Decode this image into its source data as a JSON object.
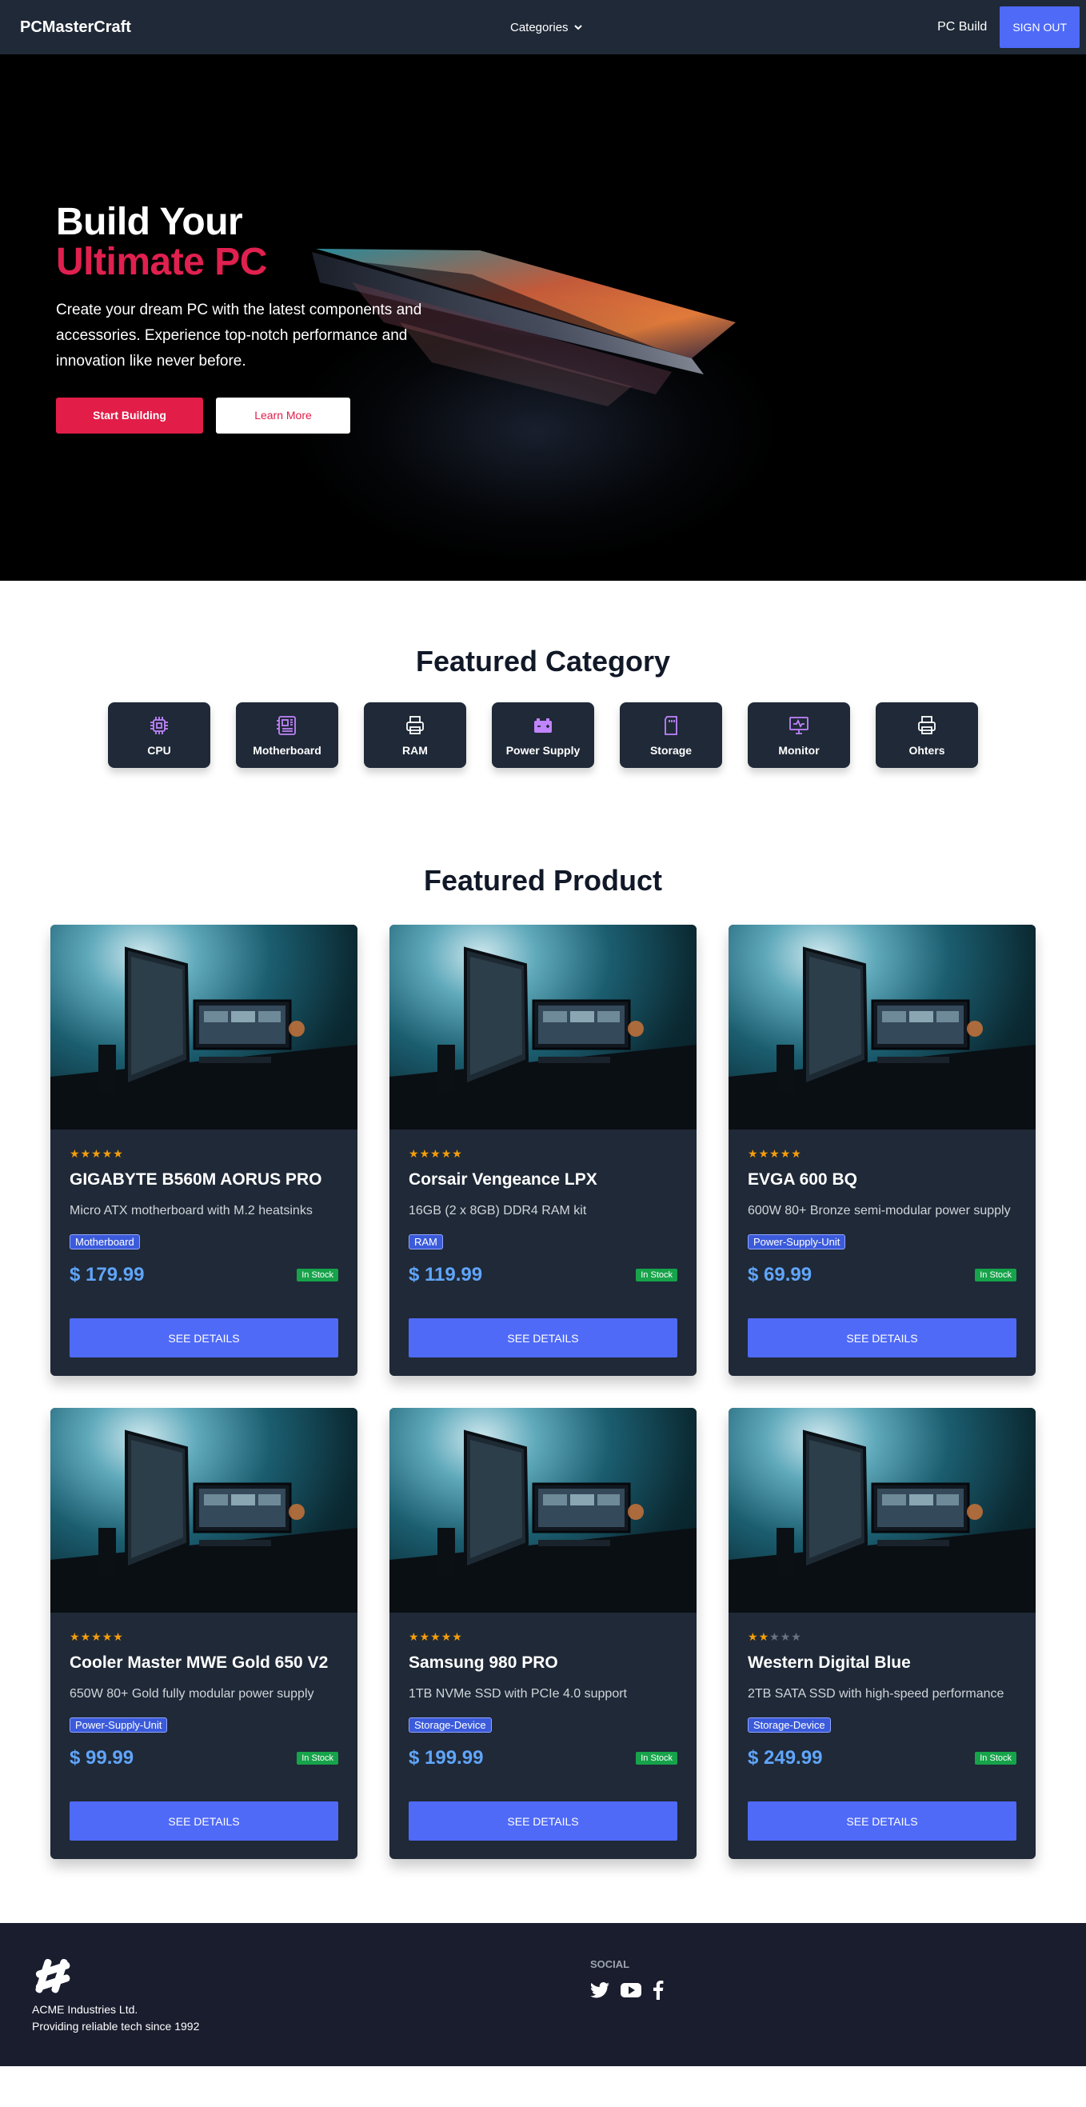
{
  "nav": {
    "brand": "PCMasterCraft",
    "categories_label": "Categories",
    "pc_build_label": "PC Build",
    "signout_label": "SIGN OUT"
  },
  "hero": {
    "title_line1": "Build Your",
    "title_line2": "Ultimate PC",
    "description": "Create your dream PC with the latest components and accessories. Experience top-notch performance and innovation like never before.",
    "primary_button": "Start Building",
    "secondary_button": "Learn More"
  },
  "featured_category": {
    "title": "Featured Category",
    "items": [
      {
        "label": "CPU",
        "icon": "cpu-icon"
      },
      {
        "label": "Motherboard",
        "icon": "motherboard-icon"
      },
      {
        "label": "RAM",
        "icon": "printer-icon"
      },
      {
        "label": "Power Supply",
        "icon": "battery-icon"
      },
      {
        "label": "Storage",
        "icon": "sd-card-icon"
      },
      {
        "label": "Monitor",
        "icon": "monitor-icon"
      },
      {
        "label": "Ohters",
        "icon": "printer-icon"
      }
    ]
  },
  "featured_product": {
    "title": "Featured Product",
    "details_label": "SEE DETAILS",
    "products": [
      {
        "name": "GIGABYTE B560M AORUS PRO",
        "description": "Micro ATX motherboard with M.2 heatsinks",
        "category": "Motherboard",
        "price": "$ 179.99",
        "status": "In Stock",
        "rating": 5
      },
      {
        "name": "Corsair Vengeance LPX",
        "description": "16GB (2 x 8GB) DDR4 RAM kit",
        "category": "RAM",
        "price": "$ 119.99",
        "status": "In Stock",
        "rating": 5
      },
      {
        "name": "EVGA 600 BQ",
        "description": "600W 80+ Bronze semi-modular power supply",
        "category": "Power-Supply-Unit",
        "price": "$ 69.99",
        "status": "In Stock",
        "rating": 5
      },
      {
        "name": "Cooler Master MWE Gold 650 V2",
        "description": "650W 80+ Gold fully modular power supply",
        "category": "Power-Supply-Unit",
        "price": "$ 99.99",
        "status": "In Stock",
        "rating": 5
      },
      {
        "name": "Samsung 980 PRO",
        "description": "1TB NVMe SSD with PCIe 4.0 support",
        "category": "Storage-Device",
        "price": "$ 199.99",
        "status": "In Stock",
        "rating": 5
      },
      {
        "name": "Western Digital Blue",
        "description": "2TB SATA SSD with high-speed performance",
        "category": "Storage-Device",
        "price": "$ 249.99",
        "status": "In Stock",
        "rating": 2
      }
    ]
  },
  "footer": {
    "company_line1": "ACME Industries Ltd.",
    "company_line2": "Providing reliable tech since 1992",
    "social_title": "SOCIAL",
    "social_icons": [
      "twitter-icon",
      "youtube-icon",
      "facebook-icon"
    ]
  },
  "colors": {
    "nav_bg": "#1f2937",
    "accent_red": "#e11d48",
    "accent_blue": "#4f6af7",
    "icon_purple": "#c084fc",
    "price_blue": "#60a5fa",
    "stock_green": "#16a34a",
    "footer_bg": "#1a1d2e"
  }
}
